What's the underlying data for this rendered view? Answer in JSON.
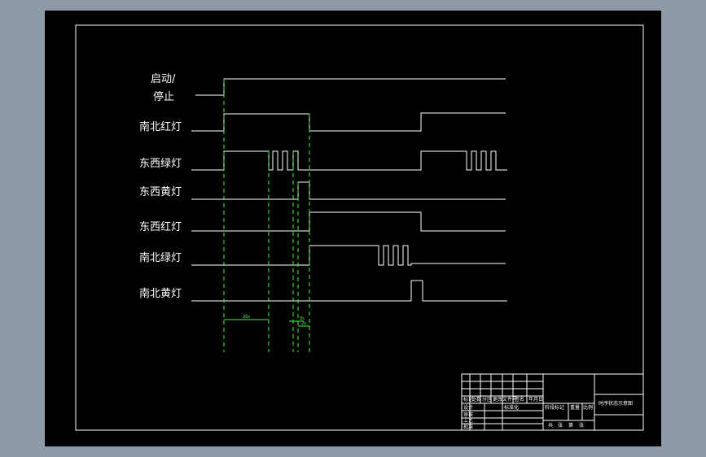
{
  "signals": [
    {
      "label_line1": "启动/",
      "label_line2": "停止"
    },
    {
      "label": "南北红灯"
    },
    {
      "label": "东西绿灯"
    },
    {
      "label": "东西黄灯"
    },
    {
      "label": "东西红灯"
    },
    {
      "label": "南北绿灯"
    },
    {
      "label": "南北黄灯"
    }
  ],
  "timing_marks": {
    "t1": "20s",
    "t2": "3s",
    "t3": "2s"
  },
  "title_block": {
    "drawing_title": "时序状态示意图",
    "cells": [
      "标记",
      "处数",
      "分区",
      "更改文件号",
      "签名",
      "年月日",
      "设计",
      "标准化",
      "审核",
      "工艺",
      "批准",
      "阶段标记",
      "重量",
      "比例",
      "共",
      "张",
      "第",
      "张"
    ]
  },
  "colors": {
    "background_sheet": "#000000",
    "signal_line": "#ffffff",
    "dashed_guides": "#33ff33",
    "frame": "#ffffff",
    "outer_gray": "#8f9aa8"
  }
}
